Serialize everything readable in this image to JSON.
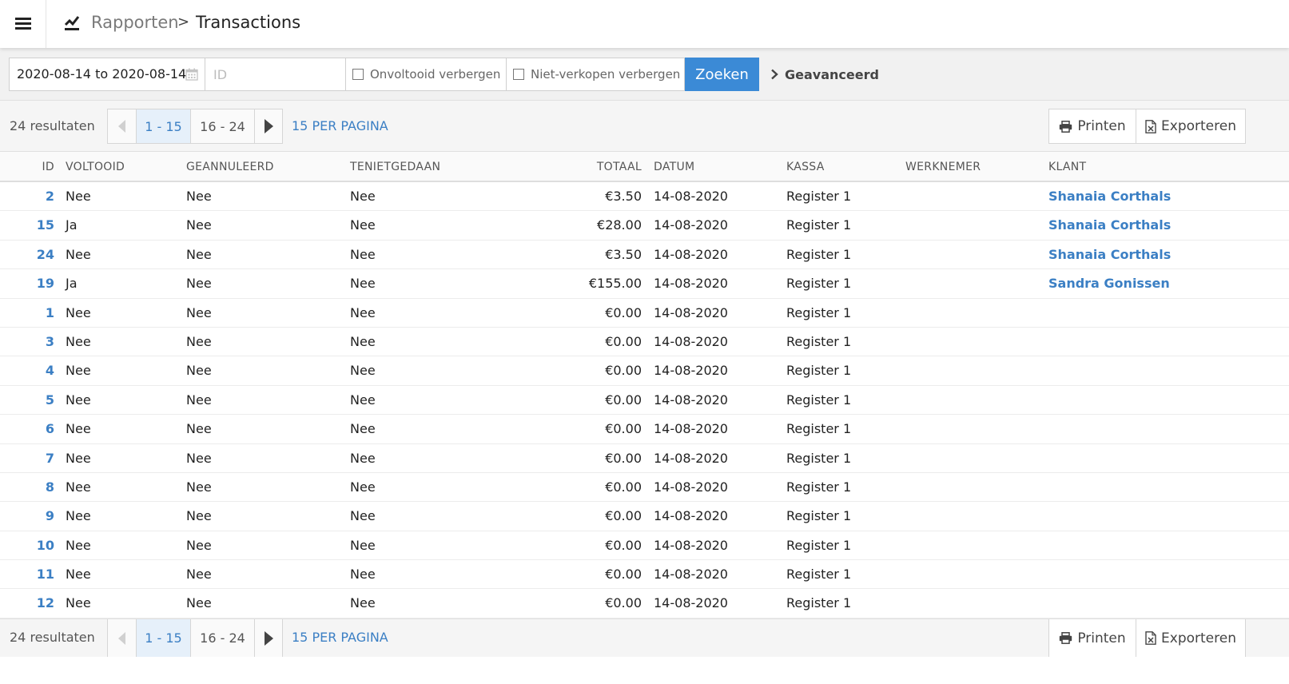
{
  "header": {
    "breadcrumb_parent": "Rapporten",
    "breadcrumb_separator": ">",
    "breadcrumb_current": "Transactions"
  },
  "filters": {
    "date_range": "2020-08-14 to 2020-08-14",
    "id_placeholder": "ID",
    "hide_incomplete_label": "Onvoltooid verbergen",
    "hide_nonsales_label": "Niet-verkopen verbergen",
    "search_label": "Zoeken",
    "advanced_label": "Geavanceerd"
  },
  "pagination": {
    "results_label": "24 resultaten",
    "pages": [
      "1 - 15",
      "16 - 24"
    ],
    "per_page_label": "15 PER PAGINA",
    "print_label": "Printen",
    "export_label": "Exporteren"
  },
  "table": {
    "columns": [
      "ID",
      "VOLTOOID",
      "GEANNULEERD",
      "TENIETGEDAAN",
      "TOTAAL",
      "DATUM",
      "KASSA",
      "WERKNEMER",
      "KLANT"
    ],
    "rows": [
      {
        "id": "2",
        "voltooid": "Nee",
        "geannuleerd": "Nee",
        "tenietgedaan": "Nee",
        "totaal": "€3.50",
        "datum": "14-08-2020",
        "kassa": "Register 1",
        "werknemer": "",
        "klant": "Shanaia Corthals"
      },
      {
        "id": "15",
        "voltooid": "Ja",
        "geannuleerd": "Nee",
        "tenietgedaan": "Nee",
        "totaal": "€28.00",
        "datum": "14-08-2020",
        "kassa": "Register 1",
        "werknemer": "",
        "klant": "Shanaia Corthals"
      },
      {
        "id": "24",
        "voltooid": "Nee",
        "geannuleerd": "Nee",
        "tenietgedaan": "Nee",
        "totaal": "€3.50",
        "datum": "14-08-2020",
        "kassa": "Register 1",
        "werknemer": "",
        "klant": "Shanaia Corthals"
      },
      {
        "id": "19",
        "voltooid": "Ja",
        "geannuleerd": "Nee",
        "tenietgedaan": "Nee",
        "totaal": "€155.00",
        "datum": "14-08-2020",
        "kassa": "Register 1",
        "werknemer": "",
        "klant": "Sandra Gonissen"
      },
      {
        "id": "1",
        "voltooid": "Nee",
        "geannuleerd": "Nee",
        "tenietgedaan": "Nee",
        "totaal": "€0.00",
        "datum": "14-08-2020",
        "kassa": "Register 1",
        "werknemer": "",
        "klant": ""
      },
      {
        "id": "3",
        "voltooid": "Nee",
        "geannuleerd": "Nee",
        "tenietgedaan": "Nee",
        "totaal": "€0.00",
        "datum": "14-08-2020",
        "kassa": "Register 1",
        "werknemer": "",
        "klant": ""
      },
      {
        "id": "4",
        "voltooid": "Nee",
        "geannuleerd": "Nee",
        "tenietgedaan": "Nee",
        "totaal": "€0.00",
        "datum": "14-08-2020",
        "kassa": "Register 1",
        "werknemer": "",
        "klant": ""
      },
      {
        "id": "5",
        "voltooid": "Nee",
        "geannuleerd": "Nee",
        "tenietgedaan": "Nee",
        "totaal": "€0.00",
        "datum": "14-08-2020",
        "kassa": "Register 1",
        "werknemer": "",
        "klant": ""
      },
      {
        "id": "6",
        "voltooid": "Nee",
        "geannuleerd": "Nee",
        "tenietgedaan": "Nee",
        "totaal": "€0.00",
        "datum": "14-08-2020",
        "kassa": "Register 1",
        "werknemer": "",
        "klant": ""
      },
      {
        "id": "7",
        "voltooid": "Nee",
        "geannuleerd": "Nee",
        "tenietgedaan": "Nee",
        "totaal": "€0.00",
        "datum": "14-08-2020",
        "kassa": "Register 1",
        "werknemer": "",
        "klant": ""
      },
      {
        "id": "8",
        "voltooid": "Nee",
        "geannuleerd": "Nee",
        "tenietgedaan": "Nee",
        "totaal": "€0.00",
        "datum": "14-08-2020",
        "kassa": "Register 1",
        "werknemer": "",
        "klant": ""
      },
      {
        "id": "9",
        "voltooid": "Nee",
        "geannuleerd": "Nee",
        "tenietgedaan": "Nee",
        "totaal": "€0.00",
        "datum": "14-08-2020",
        "kassa": "Register 1",
        "werknemer": "",
        "klant": ""
      },
      {
        "id": "10",
        "voltooid": "Nee",
        "geannuleerd": "Nee",
        "tenietgedaan": "Nee",
        "totaal": "€0.00",
        "datum": "14-08-2020",
        "kassa": "Register 1",
        "werknemer": "",
        "klant": ""
      },
      {
        "id": "11",
        "voltooid": "Nee",
        "geannuleerd": "Nee",
        "tenietgedaan": "Nee",
        "totaal": "€0.00",
        "datum": "14-08-2020",
        "kassa": "Register 1",
        "werknemer": "",
        "klant": ""
      },
      {
        "id": "12",
        "voltooid": "Nee",
        "geannuleerd": "Nee",
        "tenietgedaan": "Nee",
        "totaal": "€0.00",
        "datum": "14-08-2020",
        "kassa": "Register 1",
        "werknemer": "",
        "klant": ""
      }
    ]
  },
  "icons": {
    "menu": "hamburger-icon",
    "reports": "chart-line-icon",
    "calendar": "calendar-icon",
    "advanced": "chevron-right-icon",
    "print": "printer-icon",
    "export": "excel-file-icon"
  },
  "colors": {
    "accent": "#3b8ad6",
    "link": "#3b7fc4"
  }
}
